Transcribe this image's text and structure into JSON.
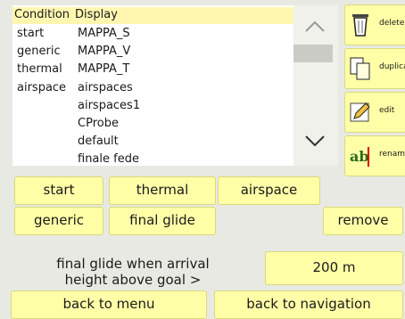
{
  "list": {
    "headers": [
      "Condition",
      "Display"
    ],
    "rows": [
      [
        "start",
        "MAPPA_S"
      ],
      [
        "generic",
        "MAPPA_V"
      ],
      [
        "thermal",
        "MAPPA_T"
      ],
      [
        "airspace",
        "airspaces"
      ],
      [
        "",
        "airspaces1"
      ],
      [
        "",
        "CProbe"
      ],
      [
        "",
        "default"
      ],
      [
        "",
        "finale fede"
      ]
    ]
  },
  "scroll": {
    "up_icon": "chevron-up-icon",
    "down_icon": "chevron-down-icon"
  },
  "side_buttons": [
    {
      "label": "delete",
      "icon": "trash-icon"
    },
    {
      "label": "duplicate",
      "icon": "duplicate-icon"
    },
    {
      "label": "edit",
      "icon": "pencil-icon"
    },
    {
      "label": "rename",
      "icon": "rename-icon"
    }
  ],
  "conditions": {
    "start": "start",
    "thermal": "thermal",
    "airspace": "airspace",
    "generic": "generic",
    "final_glide": "final glide",
    "remove": "remove"
  },
  "threshold": {
    "label": "final glide when arrival height above goal >",
    "value": "200 m"
  },
  "footer": {
    "back_menu": "back to menu",
    "back_nav": "back to navigation"
  },
  "colors": {
    "button_yellow": "#ffffa8",
    "header_yellow": "#fff7b0",
    "background": "#e9e9e4"
  }
}
